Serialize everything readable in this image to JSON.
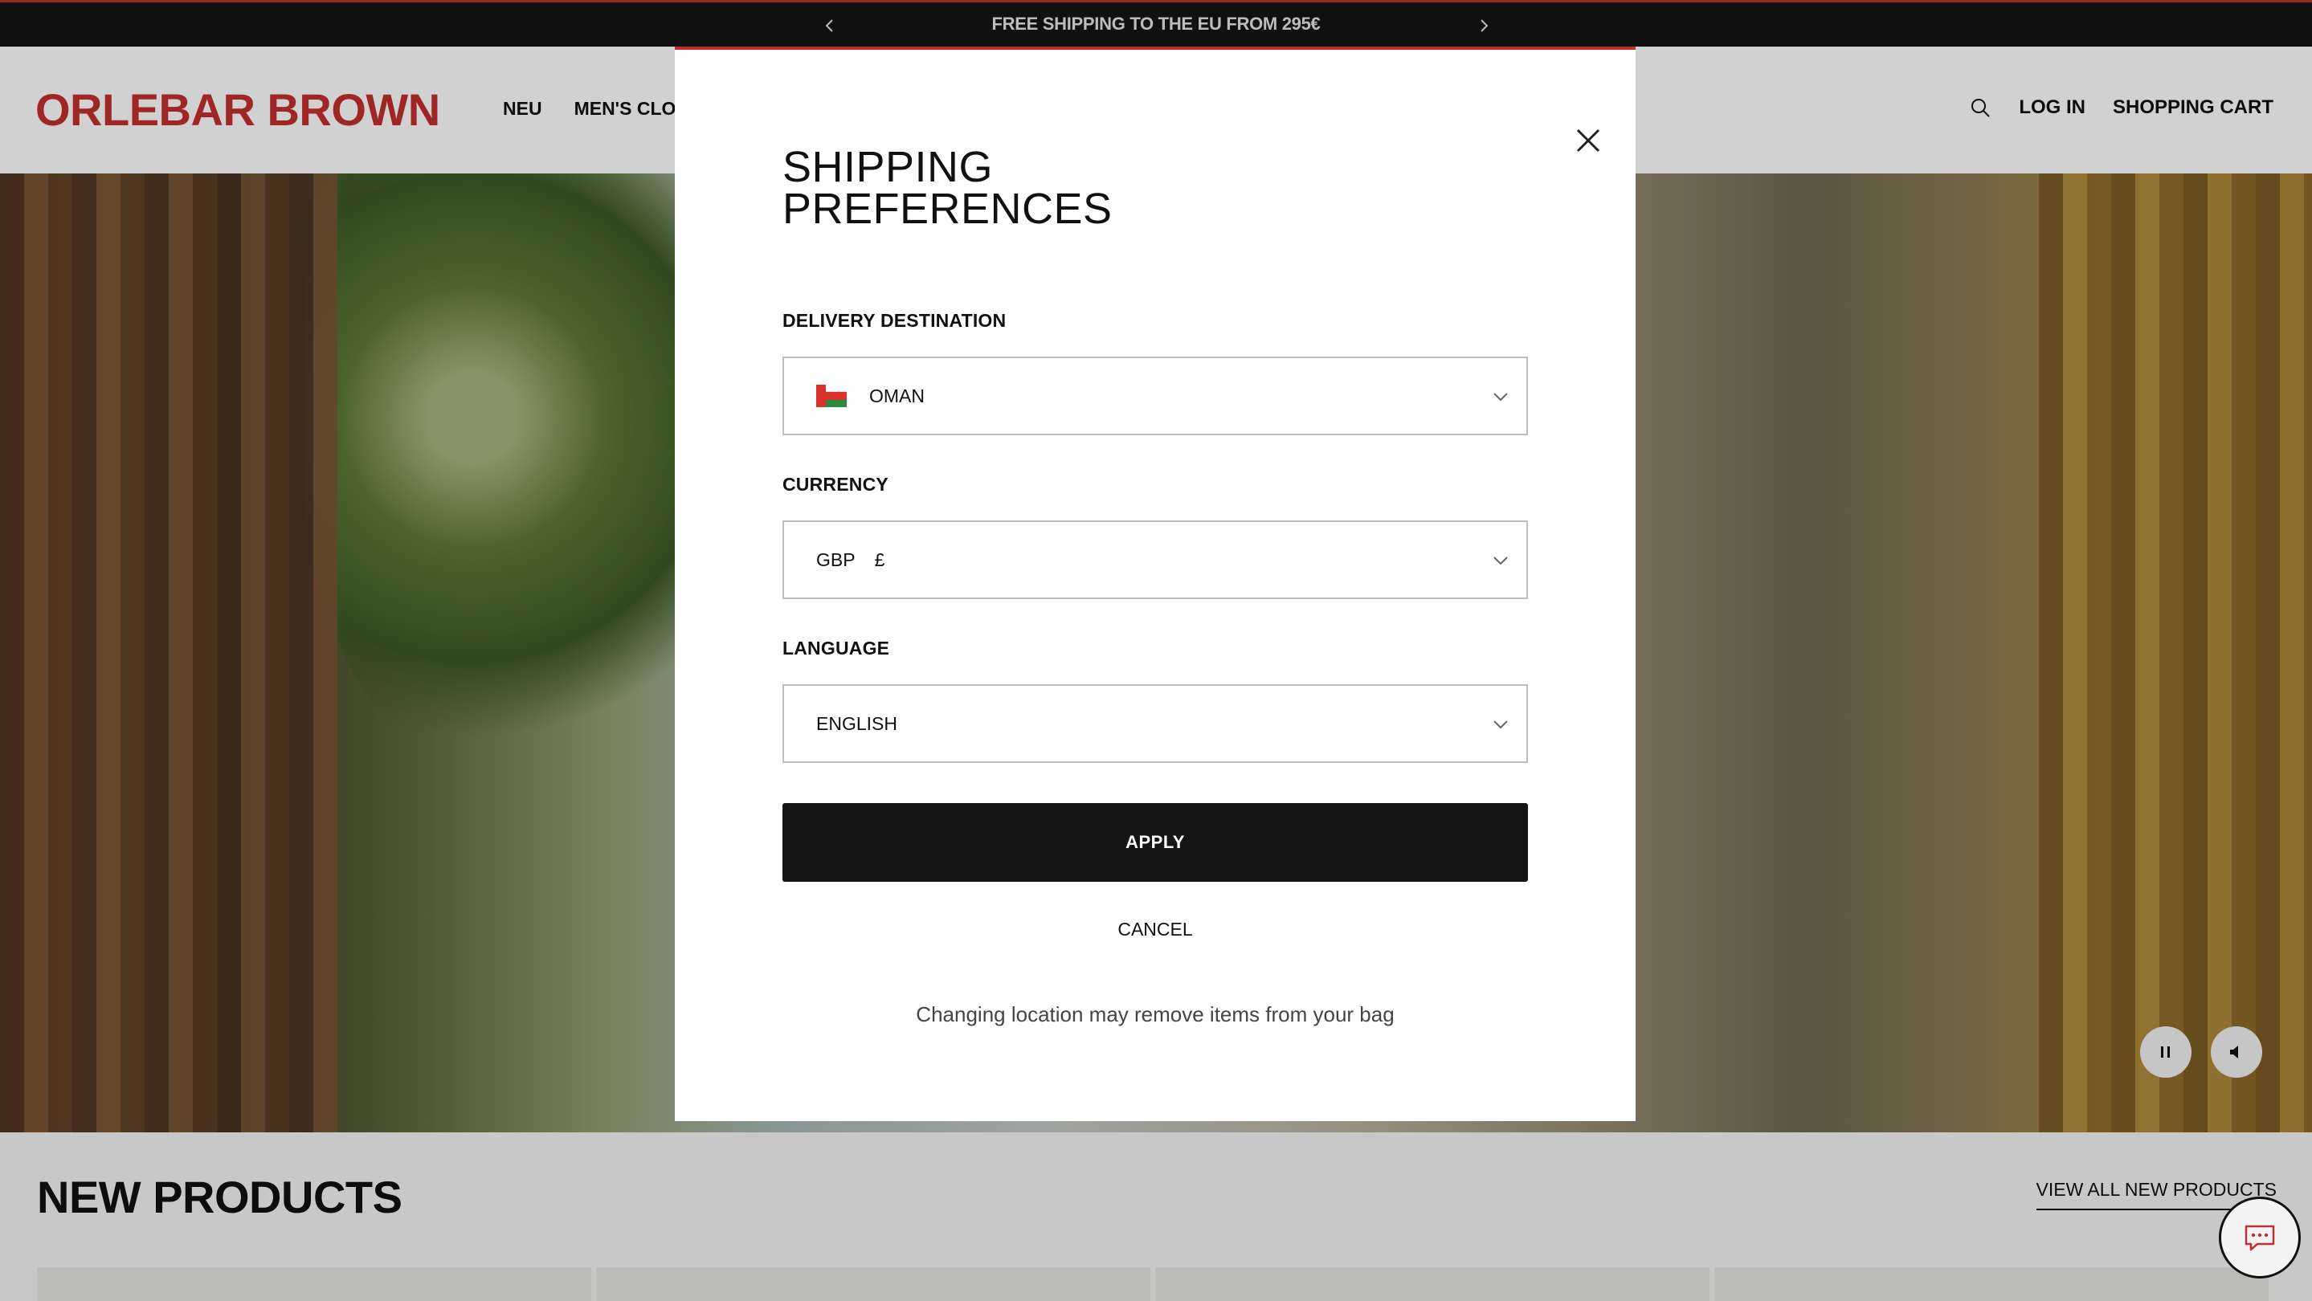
{
  "announcement": {
    "text": "FREE SHIPPING TO THE EU FROM 295€",
    "prev_icon": "chevron-left-icon",
    "next_icon": "chevron-right-icon"
  },
  "header": {
    "logo": "ORLEBAR BROWN",
    "nav": [
      {
        "label": "NEU"
      },
      {
        "label": "MEN'S CLOT"
      }
    ],
    "search_icon": "search-icon",
    "login": "LOG IN",
    "cart": "SHOPPING CART"
  },
  "hero": {
    "pause_icon": "pause-icon",
    "mute_icon": "speaker-icon"
  },
  "section": {
    "title": "NEW PRODUCTS",
    "view_all": "VIEW ALL NEW PRODUCTS",
    "chat_icon": "chat-icon"
  },
  "modal": {
    "title": "SHIPPING\nPREFERENCES",
    "close_icon": "close-icon",
    "destination": {
      "label": "DELIVERY DESTINATION",
      "value": "OMAN",
      "flag": "oman-flag-icon"
    },
    "currency": {
      "label": "CURRENCY",
      "code": "GBP",
      "symbol": "£"
    },
    "language": {
      "label": "LANGUAGE",
      "value": "ENGLISH"
    },
    "apply": "APPLY",
    "cancel": "CANCEL",
    "note": "Changing location may remove items from your bag"
  },
  "colors": {
    "brand": "#c1302e",
    "announcement_bg": "#141414",
    "apply_bg": "#151515"
  }
}
